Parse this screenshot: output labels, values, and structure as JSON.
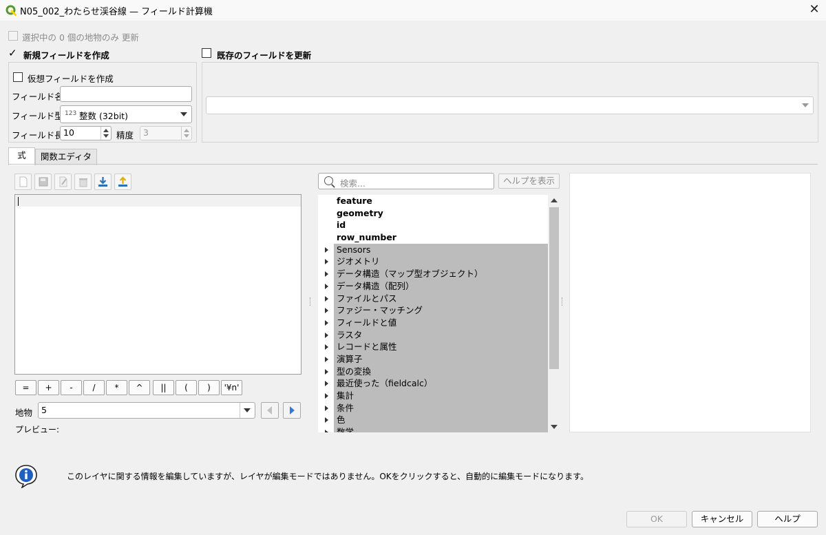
{
  "window": {
    "title": "N05_002_わたらせ渓谷線 — フィールド計算機",
    "close_glyph": "✕"
  },
  "top_options": {
    "only_selected_label": "選択中の 0 個の地物のみ 更新",
    "only_selected_checked": false,
    "create_new_label": "新規フィールドを作成",
    "create_new_checked": true,
    "update_existing_label": "既存のフィールドを更新",
    "update_existing_checked": false
  },
  "new_field": {
    "virtual_label": "仮想フィールドを作成",
    "name_label": "フィールド名",
    "name_value": "",
    "type_label": "フィールド型",
    "type_prefix": "123",
    "type_value": "整数 (32bit)",
    "length_label": "フィールド長",
    "length_value": "10",
    "precision_label": "精度",
    "precision_value": "3"
  },
  "existing_field": {
    "selected_value": ""
  },
  "tabs": [
    {
      "label": "式",
      "active": true
    },
    {
      "label": "関数エディタ",
      "active": false
    }
  ],
  "toolbar": {
    "icons": [
      "new-file-icon",
      "save-icon",
      "edit-icon",
      "delete-icon",
      "load-icon",
      "export-icon"
    ]
  },
  "operators": [
    "=",
    "+",
    "-",
    "/",
    "*",
    "^",
    "||",
    "(",
    ")",
    "'¥n'"
  ],
  "feature": {
    "label": "地物",
    "value": "5",
    "preview_label": "プレビュー:"
  },
  "function_list": {
    "search_placeholder": "検索...",
    "help_button": "ヘルプを表示",
    "plain_items": [
      "feature",
      "geometry",
      "id",
      "row_number"
    ],
    "group_items": [
      "Sensors",
      "ジオメトリ",
      "データ構造（マップ型オブジェクト）",
      "データ構造（配列）",
      "ファイルとパス",
      "ファジー・マッチング",
      "フィールドと値",
      "ラスタ",
      "レコードと属性",
      "演算子",
      "型の変換",
      "最近使った（fieldcalc）",
      "集計",
      "条件",
      "色",
      "数学"
    ]
  },
  "message": {
    "text": "このレイヤに関する情報を編集していますが、レイヤが編集モードではありません。OKをクリックすると、自動的に編集モードになります。"
  },
  "buttons": {
    "ok": "OK",
    "cancel": "キャンセル",
    "help": "ヘルプ"
  },
  "colors": {
    "qgis_green": "#589632",
    "qgis_yellow": "#ffd500",
    "nav_blue": "#2f7cd8",
    "group_highlight": "#bcbcbc"
  }
}
